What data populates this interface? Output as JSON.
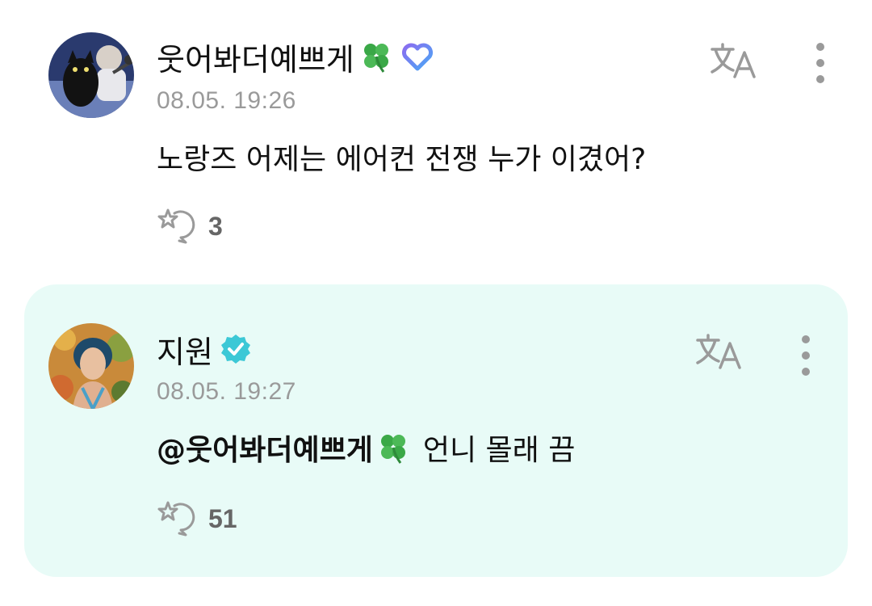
{
  "comments": [
    {
      "author": "웃어봐더예쁘게",
      "timestamp": "08.05. 19:26",
      "text": "노랑즈 어제는 에어컨 전쟁 누가 이겼어?",
      "reaction_count": "3",
      "author_badges": [
        "four-leaf-clover-icon",
        "membership-heart-icon"
      ]
    },
    {
      "author": "지원",
      "timestamp": "08.05. 19:27",
      "mention": "@웃어봐더예쁘게",
      "text": "언니 몰래 끔",
      "reaction_count": "51",
      "author_badges": [
        "verified-badge-icon"
      ]
    }
  ],
  "colors": {
    "reply_background": "#e8fbf7",
    "verified_badge": "#3cc8d6",
    "timestamp": "#9a9a9a",
    "icon_gray": "#9a9a9a"
  }
}
